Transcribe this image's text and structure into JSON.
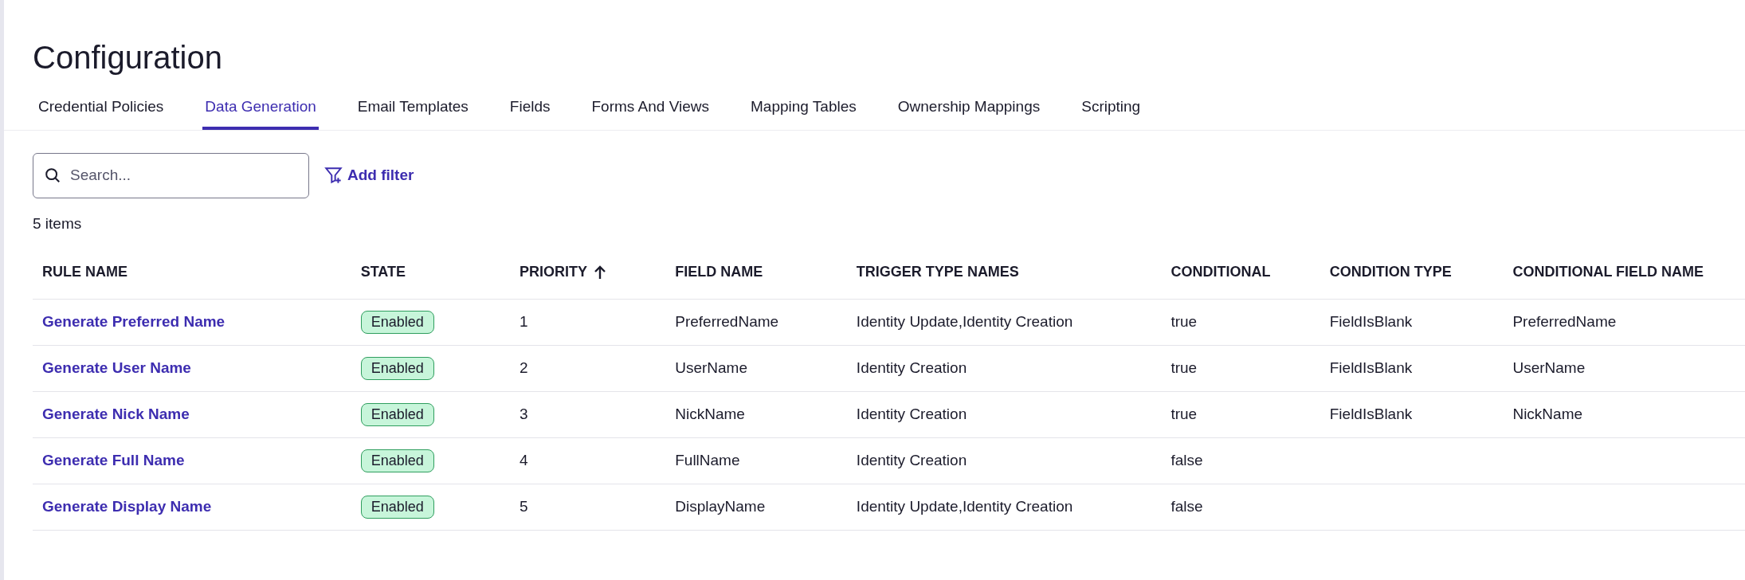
{
  "page": {
    "title": "Configuration"
  },
  "tabs": [
    {
      "label": "Credential Policies",
      "selected": false
    },
    {
      "label": "Data Generation",
      "selected": true
    },
    {
      "label": "Email Templates",
      "selected": false
    },
    {
      "label": "Fields",
      "selected": false
    },
    {
      "label": "Forms And Views",
      "selected": false
    },
    {
      "label": "Mapping Tables",
      "selected": false
    },
    {
      "label": "Ownership Mappings",
      "selected": false
    },
    {
      "label": "Scripting",
      "selected": false
    }
  ],
  "search": {
    "placeholder": "Search..."
  },
  "add_filter": "Add filter",
  "item_count": "5 items",
  "table": {
    "columns": [
      {
        "label": "RULE NAME",
        "sorted": false
      },
      {
        "label": "STATE",
        "sorted": false
      },
      {
        "label": "PRIORITY",
        "sorted": true
      },
      {
        "label": "FIELD NAME",
        "sorted": false
      },
      {
        "label": "TRIGGER TYPE NAMES",
        "sorted": false
      },
      {
        "label": "CONDITIONAL",
        "sorted": false
      },
      {
        "label": "CONDITION TYPE",
        "sorted": false
      },
      {
        "label": "CONDITIONAL FIELD NAME",
        "sorted": false
      }
    ],
    "rows": [
      [
        "Generate Preferred Name",
        "Enabled",
        "1",
        "PreferredName",
        "Identity Update,Identity Creation",
        "true",
        "FieldIsBlank",
        "PreferredName"
      ],
      [
        "Generate User Name",
        "Enabled",
        "2",
        "UserName",
        "Identity Creation",
        "true",
        "FieldIsBlank",
        "UserName"
      ],
      [
        "Generate Nick Name",
        "Enabled",
        "3",
        "NickName",
        "Identity Creation",
        "true",
        "FieldIsBlank",
        "NickName"
      ],
      [
        "Generate Full Name",
        "Enabled",
        "4",
        "FullName",
        "Identity Creation",
        "false",
        "",
        ""
      ],
      [
        "Generate Display Name",
        "Enabled",
        "5",
        "DisplayName",
        "Identity Update,Identity Creation",
        "false",
        "",
        ""
      ]
    ]
  }
}
